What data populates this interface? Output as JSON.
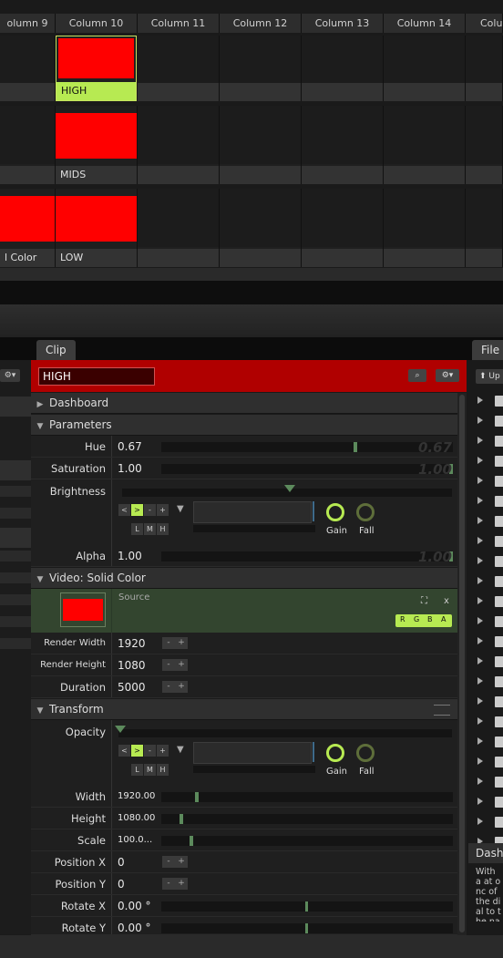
{
  "columns": [
    "olumn 9",
    "Column 10",
    "Column 11",
    "Column 12",
    "Column 13",
    "Column 14",
    "Colu"
  ],
  "clips": {
    "row1": {
      "col9": "",
      "col10": "HIGH"
    },
    "row2": {
      "col9": "",
      "col10": "MIDS"
    },
    "row3": {
      "col9": "l Color",
      "col10": "LOW"
    }
  },
  "tabs": {
    "clip": "Clip",
    "files": "File"
  },
  "clip_name": "HIGH",
  "header_buttons": {
    "search": "⌕",
    "settings": "⚙▾"
  },
  "files": {
    "up_label": "Up",
    "dashboard_label": "Dashb",
    "help_text": "With a at onc of the dial to the na"
  },
  "sections": {
    "dashboard": "Dashboard",
    "parameters": "Parameters",
    "video": "Video: Solid Color",
    "transform": "Transform"
  },
  "parameters": {
    "hue": {
      "label": "Hue",
      "value": "0.67",
      "ghost": "0.67",
      "level": 0.67
    },
    "saturation": {
      "label": "Saturation",
      "value": "1.00",
      "ghost": "1.00",
      "level": 1.0
    },
    "brightness": {
      "label": "Brightness"
    },
    "alpha": {
      "label": "Alpha",
      "value": "1.00",
      "ghost": "1.00",
      "level": 1.0
    }
  },
  "envelope": {
    "buttons": [
      "<",
      ">",
      "-",
      "+"
    ],
    "lmh": [
      "L",
      "M",
      "H"
    ],
    "gain_label": "Gain",
    "fall_label": "Fall"
  },
  "video": {
    "source_label": "Source",
    "close": "x",
    "rgba": [
      "R",
      "G",
      "B",
      "A"
    ],
    "render_width": {
      "label": "Render Width",
      "value": "1920"
    },
    "render_height": {
      "label": "Render Height",
      "value": "1080"
    },
    "duration": {
      "label": "Duration",
      "value": "5000"
    }
  },
  "transform": {
    "opacity": {
      "label": "Opacity"
    },
    "width": {
      "label": "Width",
      "value": "1920.00"
    },
    "height": {
      "label": "Height",
      "value": "1080.00"
    },
    "scale": {
      "label": "Scale",
      "value": "100.0..."
    },
    "position_x": {
      "label": "Position X",
      "value": "0"
    },
    "position_y": {
      "label": "Position Y",
      "value": "0"
    },
    "rotate_x": {
      "label": "Rotate X",
      "value": "0.00 °"
    },
    "rotate_y": {
      "label": "Rotate Y",
      "value": "0.00 °"
    }
  },
  "pm": {
    "minus": "-",
    "plus": "+"
  },
  "colors": {
    "accent": "#b7ea52",
    "clip_red": "#ff0000",
    "header_red": "#b00000"
  }
}
